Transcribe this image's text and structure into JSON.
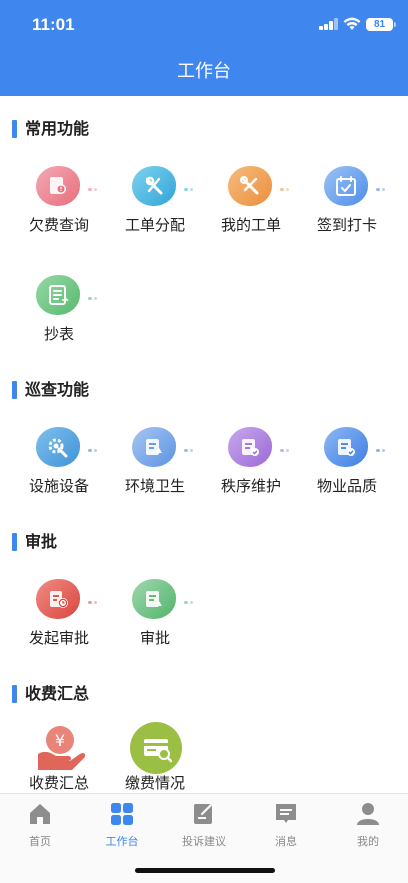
{
  "status": {
    "time": "11:01",
    "battery": "81"
  },
  "header": {
    "title": "工作台"
  },
  "sections": [
    {
      "title": "常用功能",
      "items": [
        "欠费查询",
        "工单分配",
        "我的工单",
        "签到打卡",
        "抄表"
      ]
    },
    {
      "title": "巡查功能",
      "items": [
        "设施设备",
        "环境卫生",
        "秩序维护",
        "物业品质"
      ]
    },
    {
      "title": "审批",
      "items": [
        "发起审批",
        "审批"
      ]
    },
    {
      "title": "收费汇总",
      "items": [
        "收费汇总",
        "缴费情况"
      ]
    }
  ],
  "tabs": [
    "首页",
    "工作台",
    "投诉建议",
    "消息",
    "我的"
  ],
  "colors": {
    "accent": "#3f86ee",
    "pink": "#ee7f8c",
    "cyan": "#3cb6e0",
    "orange": "#f0994e",
    "blue": "#4f8ee8",
    "green": "#63c07a",
    "purple": "#a879d8",
    "red": "#e25a52",
    "olive": "#9bbf45"
  }
}
